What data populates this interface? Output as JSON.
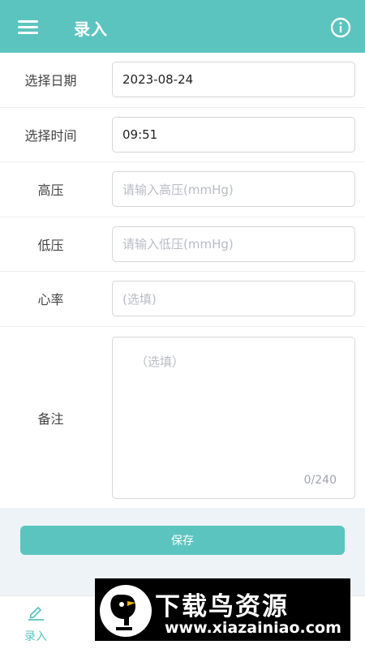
{
  "header": {
    "title": "录入",
    "menu_icon": "menu-icon",
    "info_icon": "info-icon"
  },
  "form": {
    "date": {
      "label": "选择日期",
      "value": "2023-08-24"
    },
    "time": {
      "label": "选择时间",
      "value": "09:51"
    },
    "systolic": {
      "label": "高压",
      "placeholder": "请输入高压(mmHg)"
    },
    "diastolic": {
      "label": "低压",
      "placeholder": "请输入低压(mmHg)"
    },
    "heart_rate": {
      "label": "心率",
      "placeholder": "(选填)"
    },
    "notes": {
      "label": "备注",
      "placeholder": "（选填）",
      "counter": "0/240"
    }
  },
  "save_button": {
    "label": "保存"
  },
  "tabbar": {
    "entry": {
      "label": "录入",
      "icon": "edit-icon"
    }
  },
  "watermark": {
    "name": "下载鸟资源",
    "url": "www.xiazainiao.com"
  },
  "colors": {
    "accent": "#5cc4bf",
    "background_light": "#eef3f7"
  }
}
